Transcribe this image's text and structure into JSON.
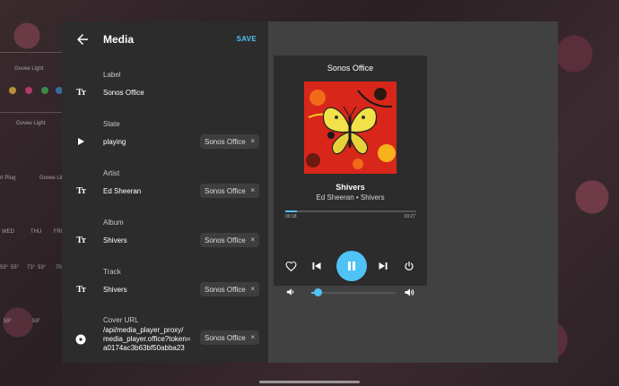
{
  "background_ui": {
    "labels": [
      "Govee Light",
      "Govee Light",
      "rt Plug",
      "Govee Lite"
    ],
    "weekdays": [
      "WED",
      "THU",
      "FRI"
    ],
    "temps_row1": [
      "59°",
      "55°",
      "73°",
      "53°",
      "70"
    ],
    "temps_row2": [
      "59°",
      "59°"
    ]
  },
  "dialog": {
    "title": "Media",
    "save_label": "SAVE",
    "fields": [
      {
        "label": "Label",
        "value": "Sonos Office",
        "icon": "text-format-icon",
        "chip": ""
      },
      {
        "label": "State",
        "value": "playing",
        "icon": "play-icon",
        "chip": "Sonos Office"
      },
      {
        "label": "Artist",
        "value": "Ed Sheeran",
        "icon": "text-format-icon",
        "chip": "Sonos Office"
      },
      {
        "label": "Album",
        "value": "Shivers",
        "icon": "text-format-icon",
        "chip": "Sonos Office"
      },
      {
        "label": "Track",
        "value": "Shivers",
        "icon": "text-format-icon",
        "chip": "Sonos Office"
      },
      {
        "label": "Cover URL",
        "value_lines": [
          "/api/media_player_proxy/",
          "media_player.office?token=",
          "a0174ac3b63bf50abba23"
        ],
        "icon": "record-icon",
        "chip": "Sonos Office"
      }
    ],
    "chip_remove": "×",
    "text_icon_glyph": "Tт"
  },
  "player": {
    "title": "Sonos Office",
    "track": "Shivers",
    "subtitle": "Ed Sheeran • Shivers",
    "elapsed": "00:18",
    "duration": "03:27",
    "progress": 0.087,
    "volume": 0.07,
    "accent": "#4fc3f7"
  }
}
